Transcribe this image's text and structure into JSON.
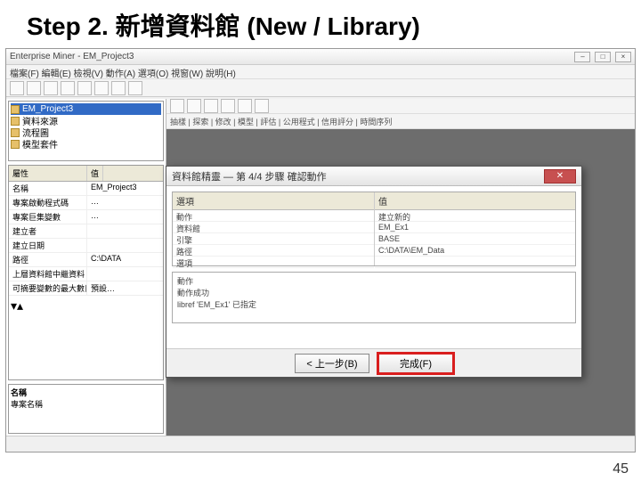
{
  "slide": {
    "title": "Step 2. 新增資料館 (New / Library)",
    "page_number": "45"
  },
  "app": {
    "title": "Enterprise Miner - EM_Project3",
    "menubar": "檔案(F) 編輯(E) 檢視(V) 動作(A) 選項(O) 視窗(W) 說明(H)",
    "win_buttons": {
      "min": "–",
      "max": "□",
      "close": "×"
    }
  },
  "tree": {
    "items": [
      {
        "label": "EM_Project3",
        "selected": true
      },
      {
        "label": "資料來源"
      },
      {
        "label": "流程圖"
      },
      {
        "label": "模型套件"
      }
    ]
  },
  "properties": {
    "head_key": "屬性",
    "head_val": "值",
    "rows": [
      {
        "k": "名稱",
        "v": "EM_Project3"
      },
      {
        "k": "專案啟動程式碼",
        "v": "…"
      },
      {
        "k": "專案巨集變數",
        "v": "…"
      },
      {
        "k": "建立者",
        "v": ""
      },
      {
        "k": "建立日期",
        "v": ""
      },
      {
        "k": "路徑",
        "v": "C:\\DATA"
      },
      {
        "k": "上層資料館中繼資料",
        "v": ""
      },
      {
        "k": "可摘要變數的最大數目",
        "v": "預設…"
      }
    ]
  },
  "name_panel": {
    "label": "名稱",
    "desc": "專案名稱"
  },
  "canvas_tabs": "抽樣 | 探索 | 修改 | 模型 | 評估 | 公用程式 | 信用評分 | 時間序列",
  "dialog": {
    "title": "資料館精靈 — 第 4/4 步驟 確認動作",
    "close_glyph": "✕",
    "left_header": "選項",
    "right_header": "值",
    "left_rows": [
      "動作",
      "資料館",
      "引擎",
      "路徑",
      "選項"
    ],
    "right_rows": [
      "建立新的",
      "EM_Ex1",
      "BASE",
      "C:\\DATA\\EM_Data",
      ""
    ],
    "lower": [
      "動作",
      "動作成功"
    ],
    "lower_result": "libref 'EM_Ex1' 已指定",
    "btn_back": "< 上一步(B)",
    "btn_finish": "完成(F)"
  }
}
